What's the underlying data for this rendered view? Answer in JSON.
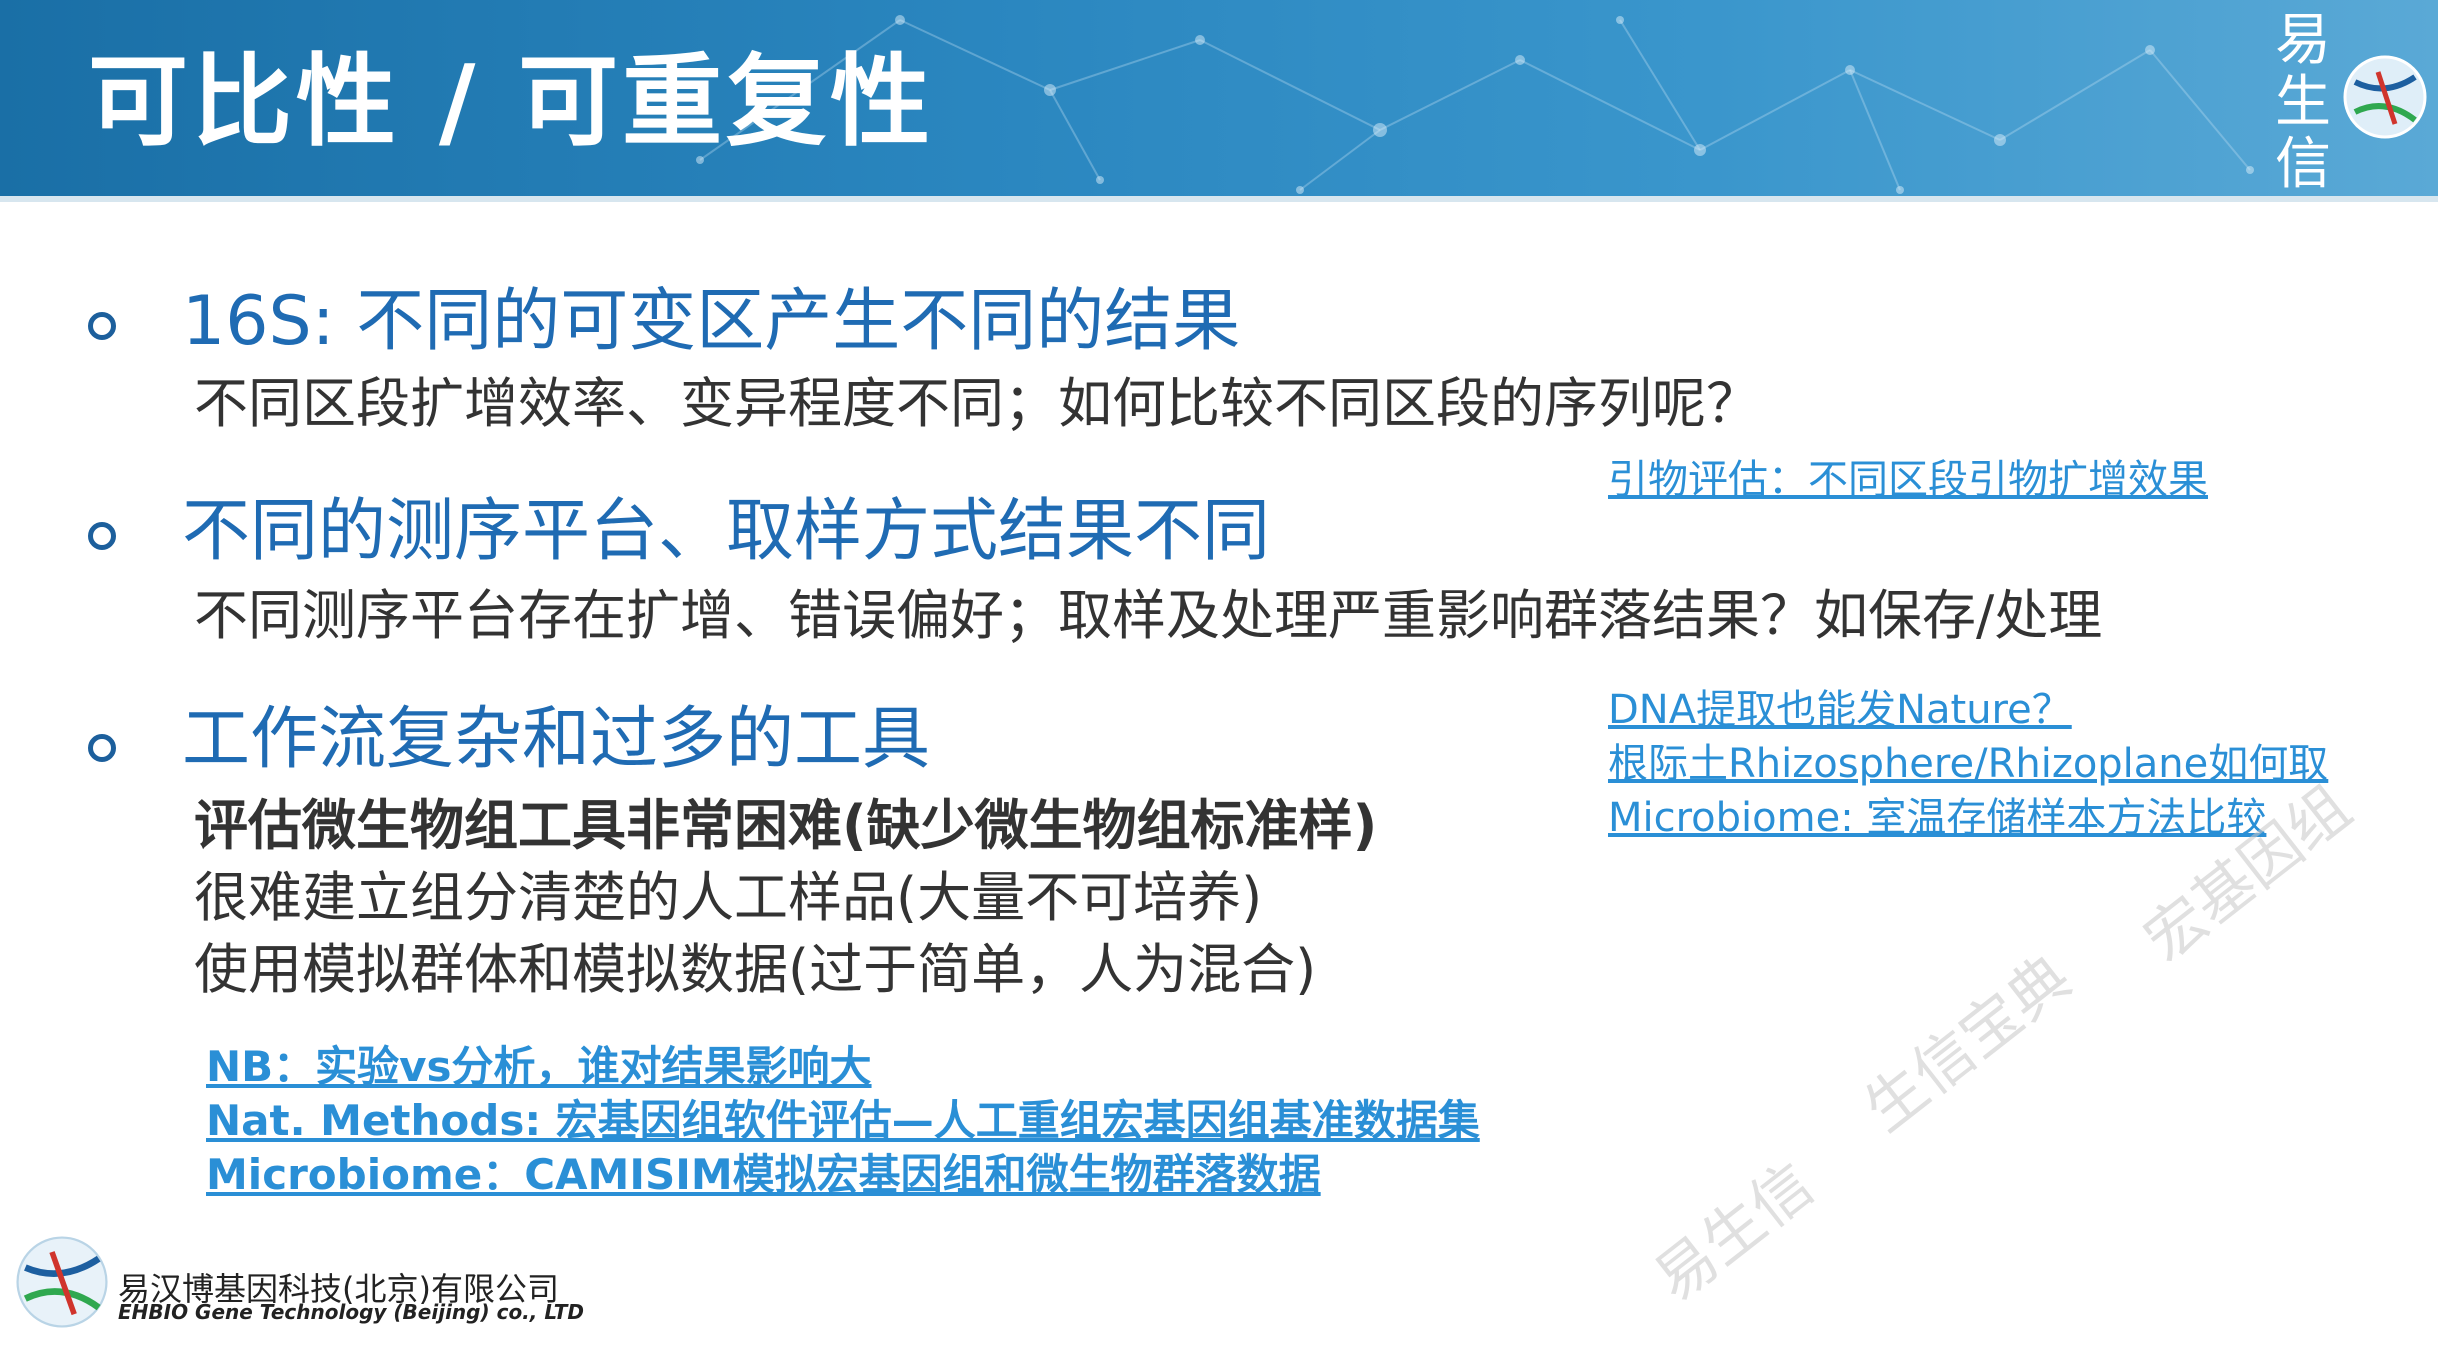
{
  "header": {
    "title": "可比性 / 可重复性",
    "brand": [
      "易",
      "生",
      "信"
    ]
  },
  "sections": [
    {
      "heading": "16S: 不同的可变区产生不同的结果",
      "lines": [
        "不同区段扩增效率、变异程度不同；如何比较不同区段的序列呢？"
      ]
    },
    {
      "heading": "不同的测序平台、取样方式结果不同",
      "lines": [
        "不同测序平台存在扩增、错误偏好；取样及处理严重影响群落结果？如保存/处理"
      ]
    },
    {
      "heading": "工作流复杂和过多的工具",
      "bold_line": "评估微生物组工具非常困难(缺少微生物组标准样)",
      "lines": [
        "很难建立组分清楚的人工样品(大量不可培养)",
        "使用模拟群体和模拟数据(过于简单，人为混合)"
      ]
    }
  ],
  "right_links": {
    "primer": "引物评估：不同区段引物扩增效果",
    "dna": "DNA提取也能发Nature？",
    "rhizo": "根际土Rhizosphere/Rhizoplane如何取",
    "storage": "Microbiome: 室温存储样本方法比较"
  },
  "bottom_links": [
    "NB：实验vs分析，谁对结果影响大",
    "Nat. Methods: 宏基因组软件评估—人工重组宏基因组基准数据集",
    "Microbiome：CAMISIM模拟宏基因组和微生物群落数据"
  ],
  "watermarks": [
    "易生信",
    "生信宝典",
    "宏基因组"
  ],
  "company": {
    "cn": "易汉博基因科技(北京)有限公司",
    "en": "EHBIO Gene Technology (Beijing) co., LTD"
  },
  "colors": {
    "header": "#2a86bf",
    "heading": "#1f6bb3",
    "link": "#2a8fd6",
    "text": "#333333"
  }
}
